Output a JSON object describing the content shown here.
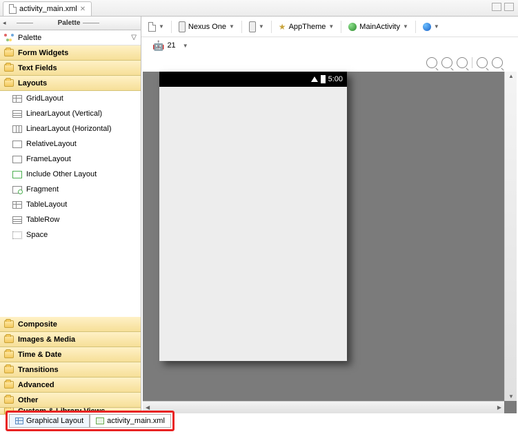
{
  "tab": {
    "title": "activity_main.xml"
  },
  "palette": {
    "header": "Palette",
    "label": "Palette",
    "categories": [
      "Form Widgets",
      "Text Fields",
      "Layouts",
      "Composite",
      "Images & Media",
      "Time & Date",
      "Transitions",
      "Advanced",
      "Other",
      "Custom & Library Views"
    ],
    "layouts_items": [
      "GridLayout",
      "LinearLayout (Vertical)",
      "LinearLayout (Horizontal)",
      "RelativeLayout",
      "FrameLayout",
      "Include Other Layout",
      "Fragment",
      "TableLayout",
      "TableRow",
      "Space"
    ]
  },
  "toolbar": {
    "device": "Nexus One",
    "theme": "AppTheme",
    "activity": "MainActivity",
    "api": "21"
  },
  "device_preview": {
    "time": "5:00"
  },
  "bottom_tabs": {
    "graphical": "Graphical Layout",
    "xml": "activity_main.xml"
  }
}
